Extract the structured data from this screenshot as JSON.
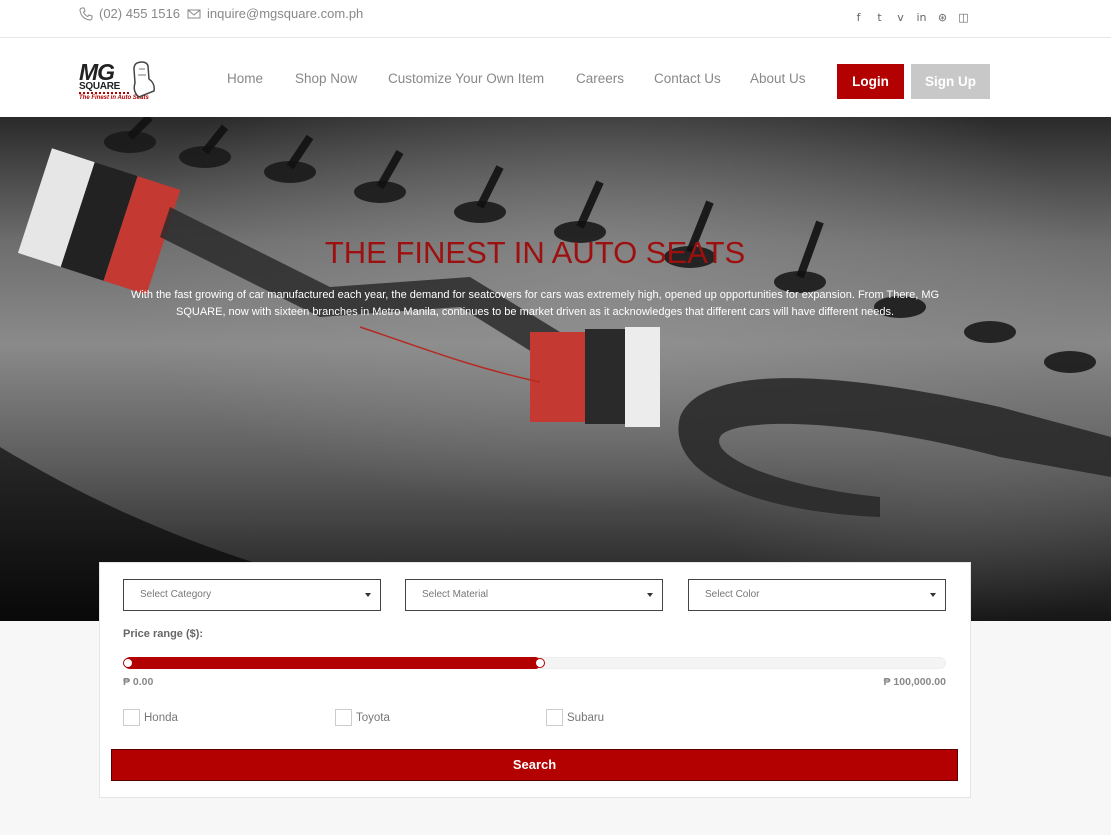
{
  "topbar": {
    "phone": "(02) 455 1516",
    "email": "inquire@mgsquare.com.ph",
    "socials": [
      {
        "icon": "facebook-icon",
        "glyph": "f"
      },
      {
        "icon": "twitter-icon",
        "glyph": "t"
      },
      {
        "icon": "vine-icon",
        "glyph": "v"
      },
      {
        "icon": "linkedin-icon",
        "glyph": "in"
      },
      {
        "icon": "dribbble-icon",
        "glyph": "⊛"
      },
      {
        "icon": "instagram-icon",
        "glyph": "◫"
      }
    ]
  },
  "logo": {
    "mg": "MG",
    "square": "SQUARE",
    "tagline": "The Finest in Auto Seats"
  },
  "nav": {
    "home": "Home",
    "shop": "Shop Now",
    "customize": "Customize Your Own Item",
    "careers": "Careers",
    "contact": "Contact Us",
    "about": "About Us",
    "login": "Login",
    "signup": "Sign Up"
  },
  "hero": {
    "title": "THE FINEST IN AUTO SEATS",
    "text": "With the fast growing of car manufactured each year, the demand for seatcovers for cars was extremely high, opened up opportunities for expansion. From There, MG SQUARE, now with sixteen branches in Metro Manila, continues to be market driven as it acknowledges that different cars will have different needs."
  },
  "filters": {
    "category_placeholder": "Select Category",
    "material_placeholder": "Select Material",
    "color_placeholder": "Select Color",
    "price_label": "Price range ($):",
    "price_min": "₱ 0.00",
    "price_max": "₱ 100,000.00",
    "price_selected_fraction": 0.5,
    "brands": [
      "Honda",
      "Toyota",
      "Subaru"
    ],
    "search_label": "Search"
  },
  "colors": {
    "accent": "#b30000",
    "title_red": "#9e1010",
    "signup_gray": "#c8c8c8"
  }
}
